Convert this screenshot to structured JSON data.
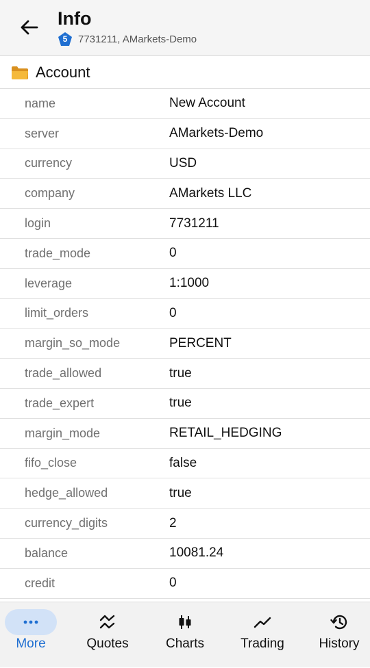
{
  "header": {
    "title": "Info",
    "badge_number": "5",
    "subtitle": "7731211, AMarkets-Demo"
  },
  "section": {
    "title": "Account"
  },
  "rows": [
    {
      "key": "name",
      "value": "New Account"
    },
    {
      "key": "server",
      "value": "AMarkets-Demo"
    },
    {
      "key": "currency",
      "value": "USD"
    },
    {
      "key": "company",
      "value": "AMarkets LLC"
    },
    {
      "key": "login",
      "value": "7731211"
    },
    {
      "key": "trade_mode",
      "value": "0"
    },
    {
      "key": "leverage",
      "value": "1:1000"
    },
    {
      "key": "limit_orders",
      "value": "0"
    },
    {
      "key": "margin_so_mode",
      "value": "PERCENT"
    },
    {
      "key": "trade_allowed",
      "value": "true"
    },
    {
      "key": "trade_expert",
      "value": "true"
    },
    {
      "key": "margin_mode",
      "value": "RETAIL_HEDGING"
    },
    {
      "key": "fifo_close",
      "value": "false"
    },
    {
      "key": "hedge_allowed",
      "value": "true"
    },
    {
      "key": "currency_digits",
      "value": "2"
    },
    {
      "key": "balance",
      "value": "10081.24"
    },
    {
      "key": "credit",
      "value": "0"
    }
  ],
  "nav": [
    {
      "label": "More",
      "icon": "more-dots-icon",
      "active": true
    },
    {
      "label": "Quotes",
      "icon": "quotes-icon",
      "active": false
    },
    {
      "label": "Charts",
      "icon": "candlestick-icon",
      "active": false
    },
    {
      "label": "Trading",
      "icon": "trending-up-icon",
      "active": false
    },
    {
      "label": "History",
      "icon": "history-icon",
      "active": false
    }
  ],
  "colors": {
    "accent": "#1f6fd1",
    "active_pill": "#d2e2f7",
    "badge": "#1f6fd1"
  }
}
